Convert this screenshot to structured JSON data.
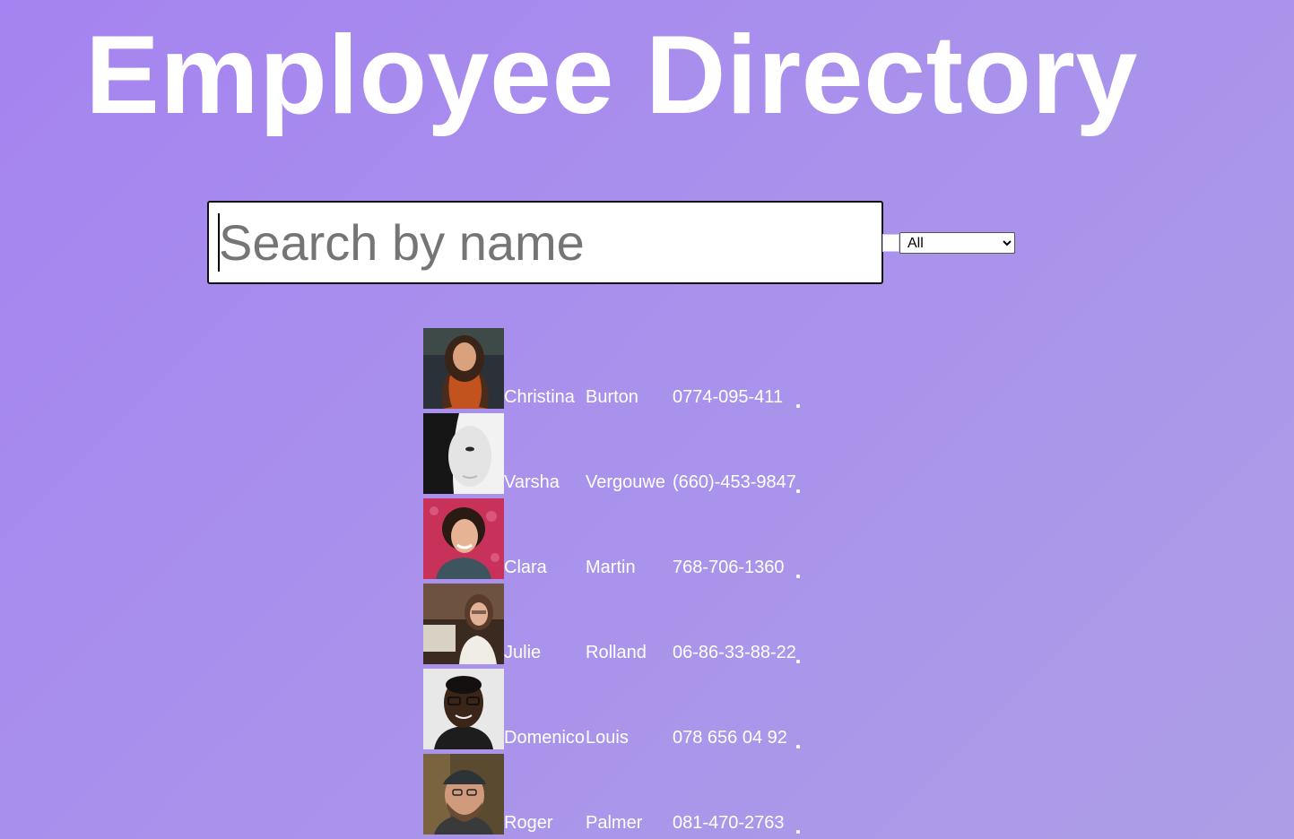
{
  "page": {
    "title": "Employee Directory"
  },
  "search": {
    "placeholder": "Search by name",
    "value": ""
  },
  "filter": {
    "selected": "All"
  },
  "employees": [
    {
      "first": "Christina",
      "last": "Burton",
      "phone": "0774-095-411",
      "avatar": "christina-avatar"
    },
    {
      "first": "Varsha",
      "last": "Vergouwe",
      "phone": "(660)-453-9847",
      "avatar": "varsha-avatar"
    },
    {
      "first": "Clara",
      "last": "Martin",
      "phone": "768-706-1360",
      "avatar": "clara-avatar"
    },
    {
      "first": "Julie",
      "last": "Rolland",
      "phone": "06-86-33-88-22",
      "avatar": "julie-avatar"
    },
    {
      "first": "Domenico",
      "last": "Louis",
      "phone": "078 656 04 92",
      "avatar": "domenico-avatar"
    },
    {
      "first": "Roger",
      "last": "Palmer",
      "phone": "081-470-2763",
      "avatar": "roger-avatar"
    }
  ],
  "colors": {
    "background_start": "#a583f0",
    "background_end": "#ad9de6",
    "text": "#ffffff"
  }
}
